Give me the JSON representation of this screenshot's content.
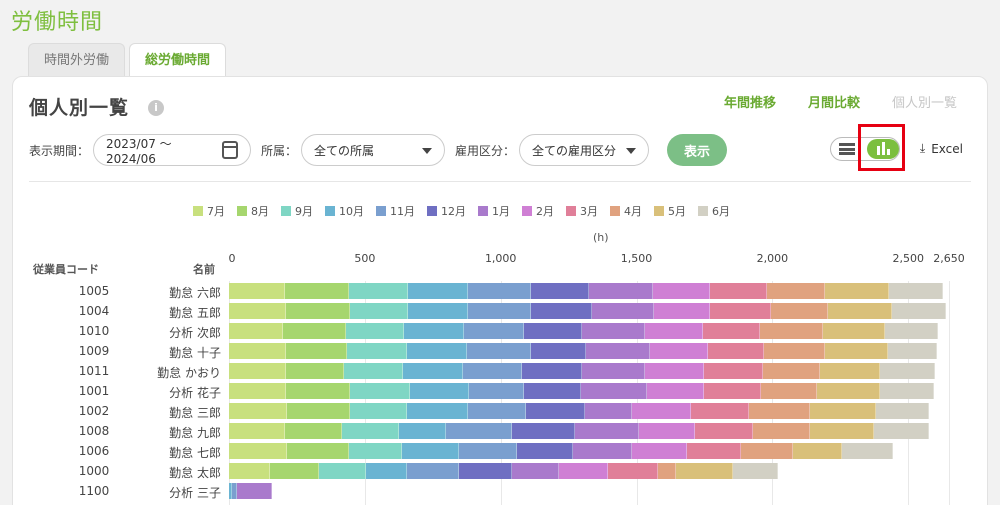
{
  "page_title": "労働時間",
  "tabs": [
    {
      "label": "時間外労働",
      "active": false
    },
    {
      "label": "総労働時間",
      "active": true
    }
  ],
  "card": {
    "title": "個人別一覧",
    "info_icon": "info-icon",
    "views": [
      {
        "label": "年間推移",
        "enabled": true
      },
      {
        "label": "月間比較",
        "enabled": true
      },
      {
        "label": "個人別一覧",
        "enabled": false
      }
    ]
  },
  "filters": {
    "period_label": "表示期間：",
    "period_value": "2023/07 〜 2024/06",
    "dept_label": "所属：",
    "dept_value": "全ての所属",
    "employment_label": "雇用区分：",
    "employment_value": "全ての雇用区分",
    "show_button": "表示"
  },
  "toolbar": {
    "list_icon": "list-icon",
    "chart_icon": "bar-chart-icon",
    "chart_view_selected": true,
    "excel_label": "Excel",
    "excel_icon": "download-icon"
  },
  "table_headers": {
    "code": "従業員コード",
    "name": "名前"
  },
  "chart_data": {
    "type": "bar",
    "orientation": "horizontal",
    "stacked": true,
    "unit": "(h)",
    "xlim": [
      0,
      2650
    ],
    "xticks": [
      "0",
      "500",
      "1,000",
      "1,500",
      "2,000",
      "2,500",
      "2,650"
    ],
    "tick_values": [
      0,
      500,
      1000,
      1500,
      2000,
      2500,
      2650
    ],
    "legend_position": "top",
    "months": [
      "7月",
      "8月",
      "9月",
      "10月",
      "11月",
      "12月",
      "1月",
      "2月",
      "3月",
      "4月",
      "5月",
      "6月"
    ],
    "colors": [
      "#c8e07e",
      "#a6d66e",
      "#7fd6c4",
      "#6ab4d2",
      "#7a9fcf",
      "#6f6fc2",
      "#a97acc",
      "#cf7fd4",
      "#e07f99",
      "#e0a27f",
      "#d9c07a",
      "#d2d0c4"
    ],
    "employees": [
      {
        "code": "1005",
        "name": "勤怠 六郎",
        "values": [
          205,
          235,
          220,
          220,
          230,
          215,
          235,
          210,
          210,
          215,
          235,
          200
        ]
      },
      {
        "code": "1004",
        "name": "勤怠 五郎",
        "values": [
          210,
          235,
          215,
          220,
          230,
          225,
          230,
          205,
          225,
          210,
          235,
          200
        ]
      },
      {
        "code": "1010",
        "name": "分析 次郎",
        "values": [
          200,
          230,
          215,
          220,
          220,
          215,
          230,
          215,
          210,
          230,
          230,
          195
        ]
      },
      {
        "code": "1009",
        "name": "勤怠 十子",
        "values": [
          210,
          225,
          220,
          220,
          235,
          205,
          235,
          215,
          205,
          225,
          230,
          180
        ]
      },
      {
        "code": "1011",
        "name": "勤怠 かおり",
        "values": [
          210,
          215,
          215,
          220,
          220,
          220,
          230,
          220,
          215,
          210,
          220,
          205
        ]
      },
      {
        "code": "1001",
        "name": "分析 花子",
        "values": [
          210,
          235,
          220,
          220,
          200,
          210,
          245,
          210,
          210,
          205,
          230,
          200
        ]
      },
      {
        "code": "1002",
        "name": "勤怠 三郎",
        "values": [
          215,
          230,
          210,
          225,
          215,
          215,
          175,
          215,
          215,
          225,
          240,
          195
        ]
      },
      {
        "code": "1008",
        "name": "勤怠 九郎",
        "values": [
          205,
          210,
          210,
          175,
          240,
          235,
          235,
          205,
          215,
          210,
          235,
          200
        ]
      },
      {
        "code": "1006",
        "name": "勤怠 七郎",
        "values": [
          215,
          225,
          195,
          210,
          215,
          205,
          220,
          200,
          200,
          190,
          180,
          190
        ]
      },
      {
        "code": "1000",
        "name": "勤怠 太郎",
        "values": [
          150,
          180,
          175,
          150,
          190,
          195,
          175,
          180,
          185,
          65,
          210,
          165
        ]
      },
      {
        "code": "1100",
        "name": "分析 三子",
        "values": [
          0,
          0,
          0,
          10,
          20,
          0,
          130,
          0,
          0,
          0,
          0,
          0
        ]
      }
    ]
  }
}
